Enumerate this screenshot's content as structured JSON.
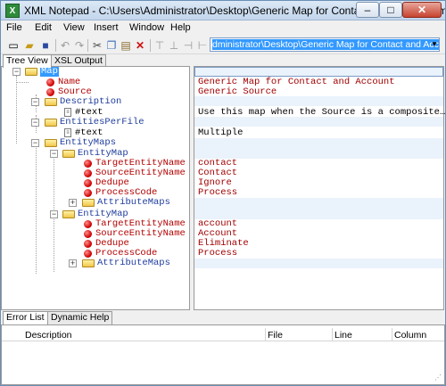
{
  "window": {
    "title": "XML Notepad - C:\\Users\\Administrator\\Desktop\\Generic Map for Contact and Account.xml",
    "app_icon_glyph": "X",
    "minimize_glyph": "–",
    "maximize_glyph": "□",
    "close_glyph": "✕"
  },
  "menu": [
    "File",
    "Edit",
    "View",
    "Insert",
    "Window",
    "Help"
  ],
  "toolbar": {
    "path_value": "dministrator\\Desktop\\Generic Map for Contact and Account.xml",
    "icons": [
      "new-icon",
      "open-icon",
      "save-icon",
      "undo-icon",
      "redo-icon",
      "cut-icon",
      "copy-icon",
      "paste-icon",
      "delete-icon",
      "nudge-up-icon",
      "nudge-down-icon",
      "nudge-left-icon",
      "nudge-right-icon"
    ]
  },
  "tabs": [
    "Tree View",
    "XSL Output"
  ],
  "tree": {
    "nodes": [
      {
        "label": "Map",
        "kind": "element"
      },
      {
        "label": "Name",
        "kind": "attribute"
      },
      {
        "label": "Source",
        "kind": "attribute"
      },
      {
        "label": "Description",
        "kind": "element"
      },
      {
        "label": "#text",
        "kind": "text"
      },
      {
        "label": "EntitiesPerFile",
        "kind": "element"
      },
      {
        "label": "#text",
        "kind": "text"
      },
      {
        "label": "EntityMaps",
        "kind": "element"
      },
      {
        "label": "EntityMap",
        "kind": "element"
      },
      {
        "label": "TargetEntityName",
        "kind": "attribute"
      },
      {
        "label": "SourceEntityName",
        "kind": "attribute"
      },
      {
        "label": "Dedupe",
        "kind": "attribute"
      },
      {
        "label": "ProcessCode",
        "kind": "attribute"
      },
      {
        "label": "AttributeMaps",
        "kind": "element"
      },
      {
        "label": "EntityMap",
        "kind": "element"
      },
      {
        "label": "TargetEntityName",
        "kind": "attribute"
      },
      {
        "label": "SourceEntityName",
        "kind": "attribute"
      },
      {
        "label": "Dedupe",
        "kind": "attribute"
      },
      {
        "label": "ProcessCode",
        "kind": "attribute"
      },
      {
        "label": "AttributeMaps",
        "kind": "element"
      }
    ]
  },
  "values": {
    "rows": [
      {
        "text": "",
        "kind": "none"
      },
      {
        "text": "Generic Map for Contact and Account",
        "kind": "attribute"
      },
      {
        "text": "Generic Source",
        "kind": "attribute"
      },
      {
        "text": "",
        "kind": "none"
      },
      {
        "text": "Use this map when the Source is a composite…",
        "kind": "text"
      },
      {
        "text": "",
        "kind": "none"
      },
      {
        "text": "Multiple",
        "kind": "text"
      },
      {
        "text": "",
        "kind": "none"
      },
      {
        "text": "",
        "kind": "none"
      },
      {
        "text": "contact",
        "kind": "attribute"
      },
      {
        "text": "Contact",
        "kind": "attribute"
      },
      {
        "text": "Ignore",
        "kind": "attribute"
      },
      {
        "text": "Process",
        "kind": "attribute"
      },
      {
        "text": "",
        "kind": "none"
      },
      {
        "text": "",
        "kind": "none"
      },
      {
        "text": "account",
        "kind": "attribute"
      },
      {
        "text": "Account",
        "kind": "attribute"
      },
      {
        "text": "Eliminate",
        "kind": "attribute"
      },
      {
        "text": "Process",
        "kind": "attribute"
      },
      {
        "text": "",
        "kind": "none"
      }
    ]
  },
  "bottom_tabs": [
    "Error List",
    "Dynamic Help"
  ],
  "error_list": {
    "columns": [
      "Description",
      "File",
      "Line",
      "Column"
    ]
  },
  "colors": {
    "element_label": "#1f3d9e",
    "attribute_label": "#b30000",
    "value_text": "#a00000",
    "selection": "#3399ff"
  }
}
